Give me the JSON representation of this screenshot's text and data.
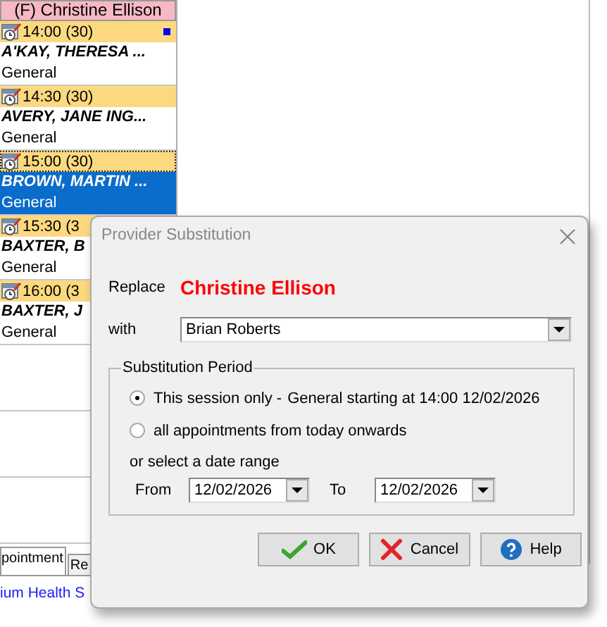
{
  "schedule": {
    "header": "(F) Christine Ellison",
    "appointments": [
      {
        "time": "14:00 (30)",
        "patient": "A'KAY, THERESA ...",
        "type": "General",
        "selected": false,
        "flagged": true
      },
      {
        "time": "14:30 (30)",
        "patient": "AVERY, JANE ING...",
        "type": "General",
        "selected": false,
        "flagged": false
      },
      {
        "time": "15:00 (30)",
        "patient": "BROWN, MARTIN ...",
        "type": "General",
        "selected": true,
        "flagged": false
      },
      {
        "time": "15:30 (3",
        "patient": "BAXTER, B",
        "type": "General",
        "selected": false
      },
      {
        "time": "16:00 (3",
        "patient": "BAXTER, J",
        "type": "General",
        "selected": false
      }
    ]
  },
  "bottom_tabs": [
    {
      "label": "pointment",
      "selected": true
    },
    {
      "label": "Re",
      "selected": false
    }
  ],
  "link": "ium Health S",
  "dialog": {
    "title": "Provider Substitution",
    "replace_label": "Replace",
    "replace_name": "Christine Ellison",
    "with_label": "with",
    "with_value": "Brian Roberts",
    "group_title": "Substitution Period",
    "options": [
      {
        "label": "This session only -",
        "detail": "General starting at 14:00 12/02/2026",
        "selected": true
      },
      {
        "label": "all appointments from today onwards",
        "selected": false
      }
    ],
    "range_hint": "or select a date range",
    "from_label": "From",
    "from_value": "12/02/2026",
    "to_label": "To",
    "to_value": "12/02/2026",
    "buttons": [
      {
        "kind": "ok",
        "label": "OK"
      },
      {
        "kind": "cancel",
        "label": "Cancel"
      },
      {
        "kind": "help",
        "label": "Help"
      }
    ]
  }
}
